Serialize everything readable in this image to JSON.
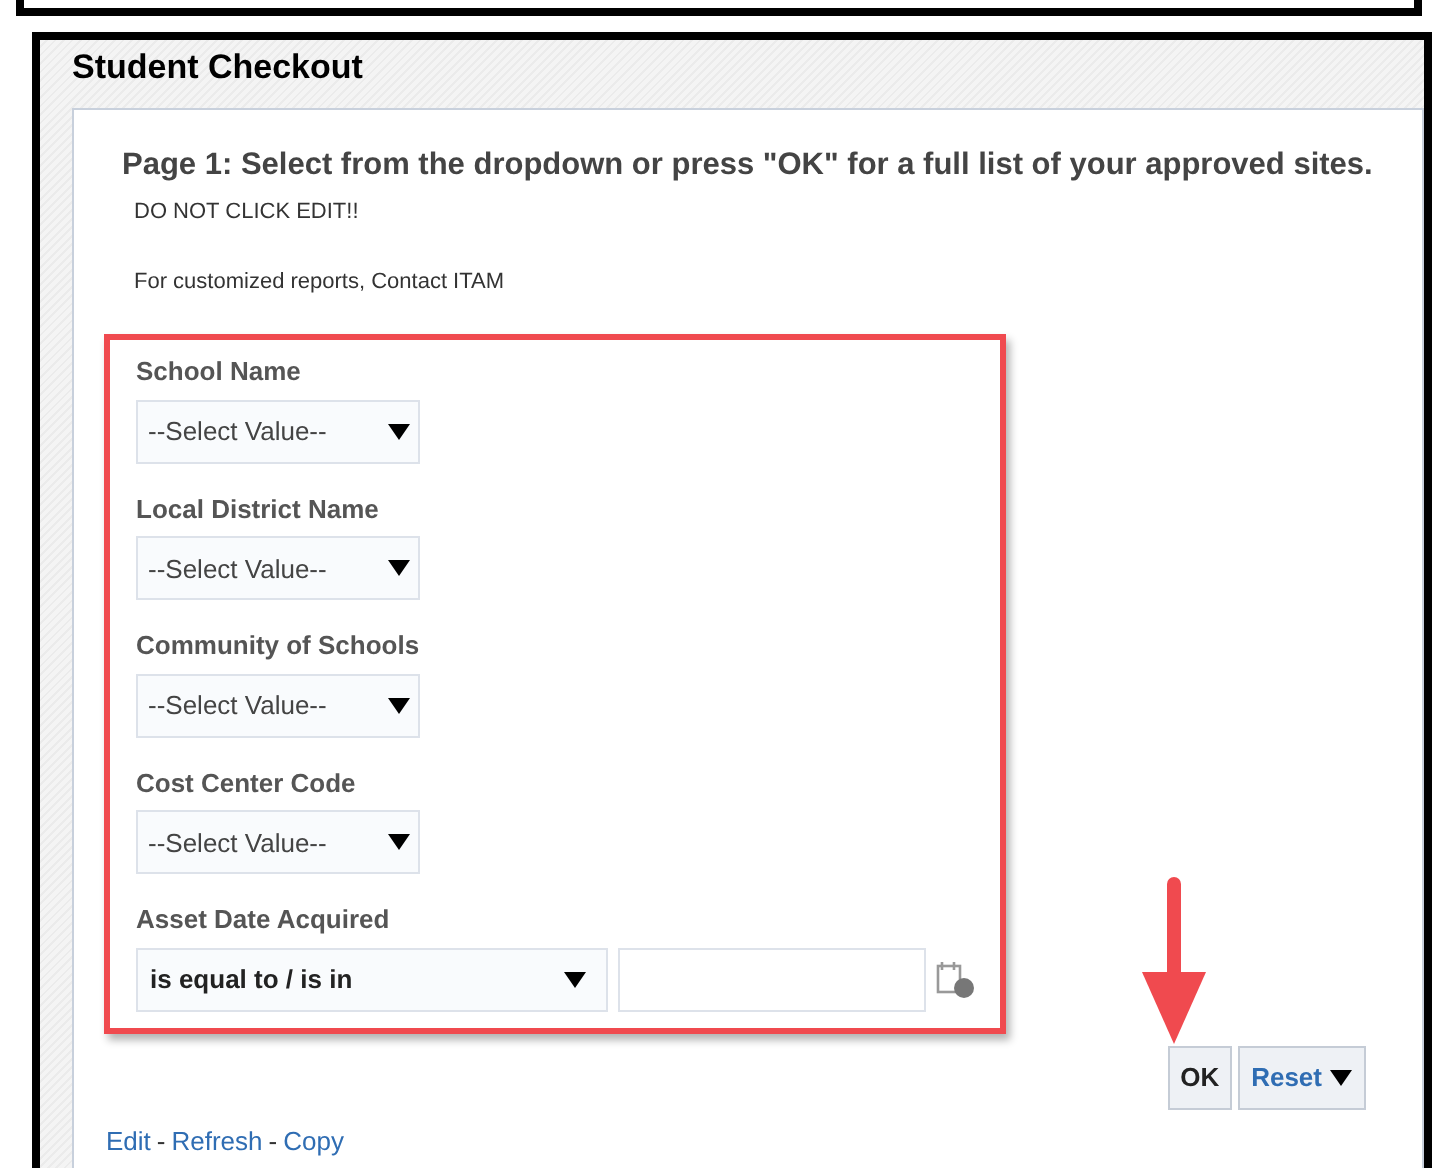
{
  "title": "Student Checkout",
  "heading": "Page 1: Select from the dropdown or press \"OK\" for a full list of your approved sites.",
  "notes": [
    "DO NOT CLICK EDIT!!",
    "For customized reports, Contact ITAM"
  ],
  "prompts": [
    {
      "label": "School Name",
      "value": "--Select Value--"
    },
    {
      "label": "Local District Name",
      "value": "--Select Value--"
    },
    {
      "label": "Community of Schools",
      "value": "--Select Value--"
    },
    {
      "label": "Cost Center Code",
      "value": "--Select Value--"
    }
  ],
  "date_prompt": {
    "label": "Asset Date Acquired",
    "operator": "is equal to / is in"
  },
  "buttons": {
    "ok": "OK",
    "reset": "Reset"
  },
  "links": [
    {
      "label": "Edit",
      "separator": "-"
    },
    {
      "label": "Refresh",
      "separator": "-"
    },
    {
      "label": "Copy"
    }
  ]
}
